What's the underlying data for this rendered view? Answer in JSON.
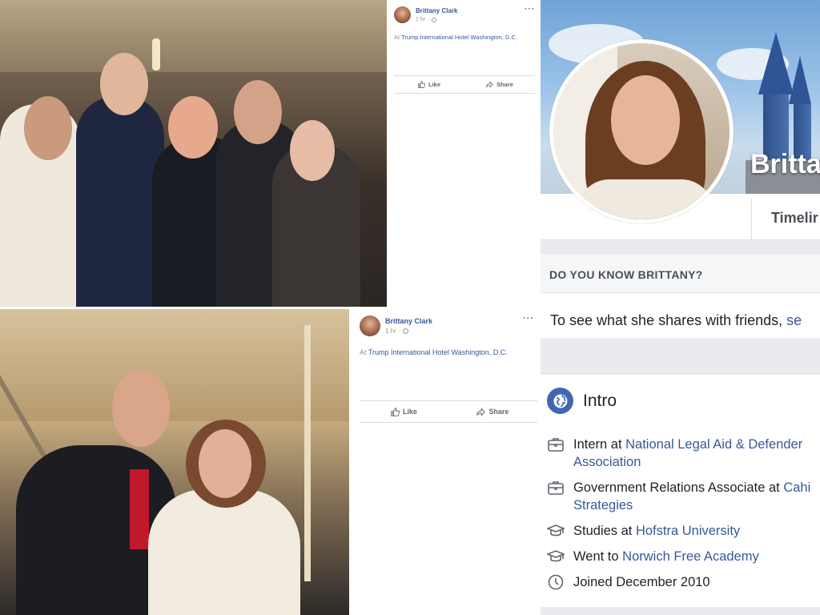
{
  "posts": [
    {
      "author": "Brittany Clark",
      "time": "1 hr",
      "more": "···",
      "location_prefix": "At ",
      "location": "Trump International Hotel Washington, D.C.",
      "like_label": "Like",
      "share_label": "Share"
    },
    {
      "author": "Brittany Clark",
      "time": "1 hr",
      "more": "···",
      "location_prefix": "At ",
      "location": "Trump International Hotel Washington, D.C.",
      "like_label": "Like",
      "share_label": "Share"
    }
  ],
  "profile": {
    "cover_name": "Brittar",
    "tab_timeline": "Timelir",
    "know_title": "DO YOU KNOW BRITTANY?",
    "know_text": "To see what she shares with friends, ",
    "know_link": "se",
    "intro_title": "Intro",
    "intro_items": [
      {
        "icon": "briefcase-icon",
        "prefix": "Intern at ",
        "link_line1": "National Legal Aid & Defender",
        "link_line2": "Association"
      },
      {
        "icon": "briefcase-icon",
        "prefix": "Government Relations Associate at ",
        "link_line1": "Cahi",
        "link_line2": "Strategies"
      },
      {
        "icon": "graduation-cap-icon",
        "prefix": "Studies at ",
        "link_line1": "Hofstra University"
      },
      {
        "icon": "graduation-cap-icon",
        "prefix": "Went to ",
        "link_line1": "Norwich Free Academy"
      },
      {
        "icon": "clock-icon",
        "prefix": "Joined December 2010"
      }
    ]
  },
  "colors": {
    "link": "#385898",
    "brand": "#4267b2",
    "muted": "#90949c",
    "page_bg": "#e9ebee"
  }
}
